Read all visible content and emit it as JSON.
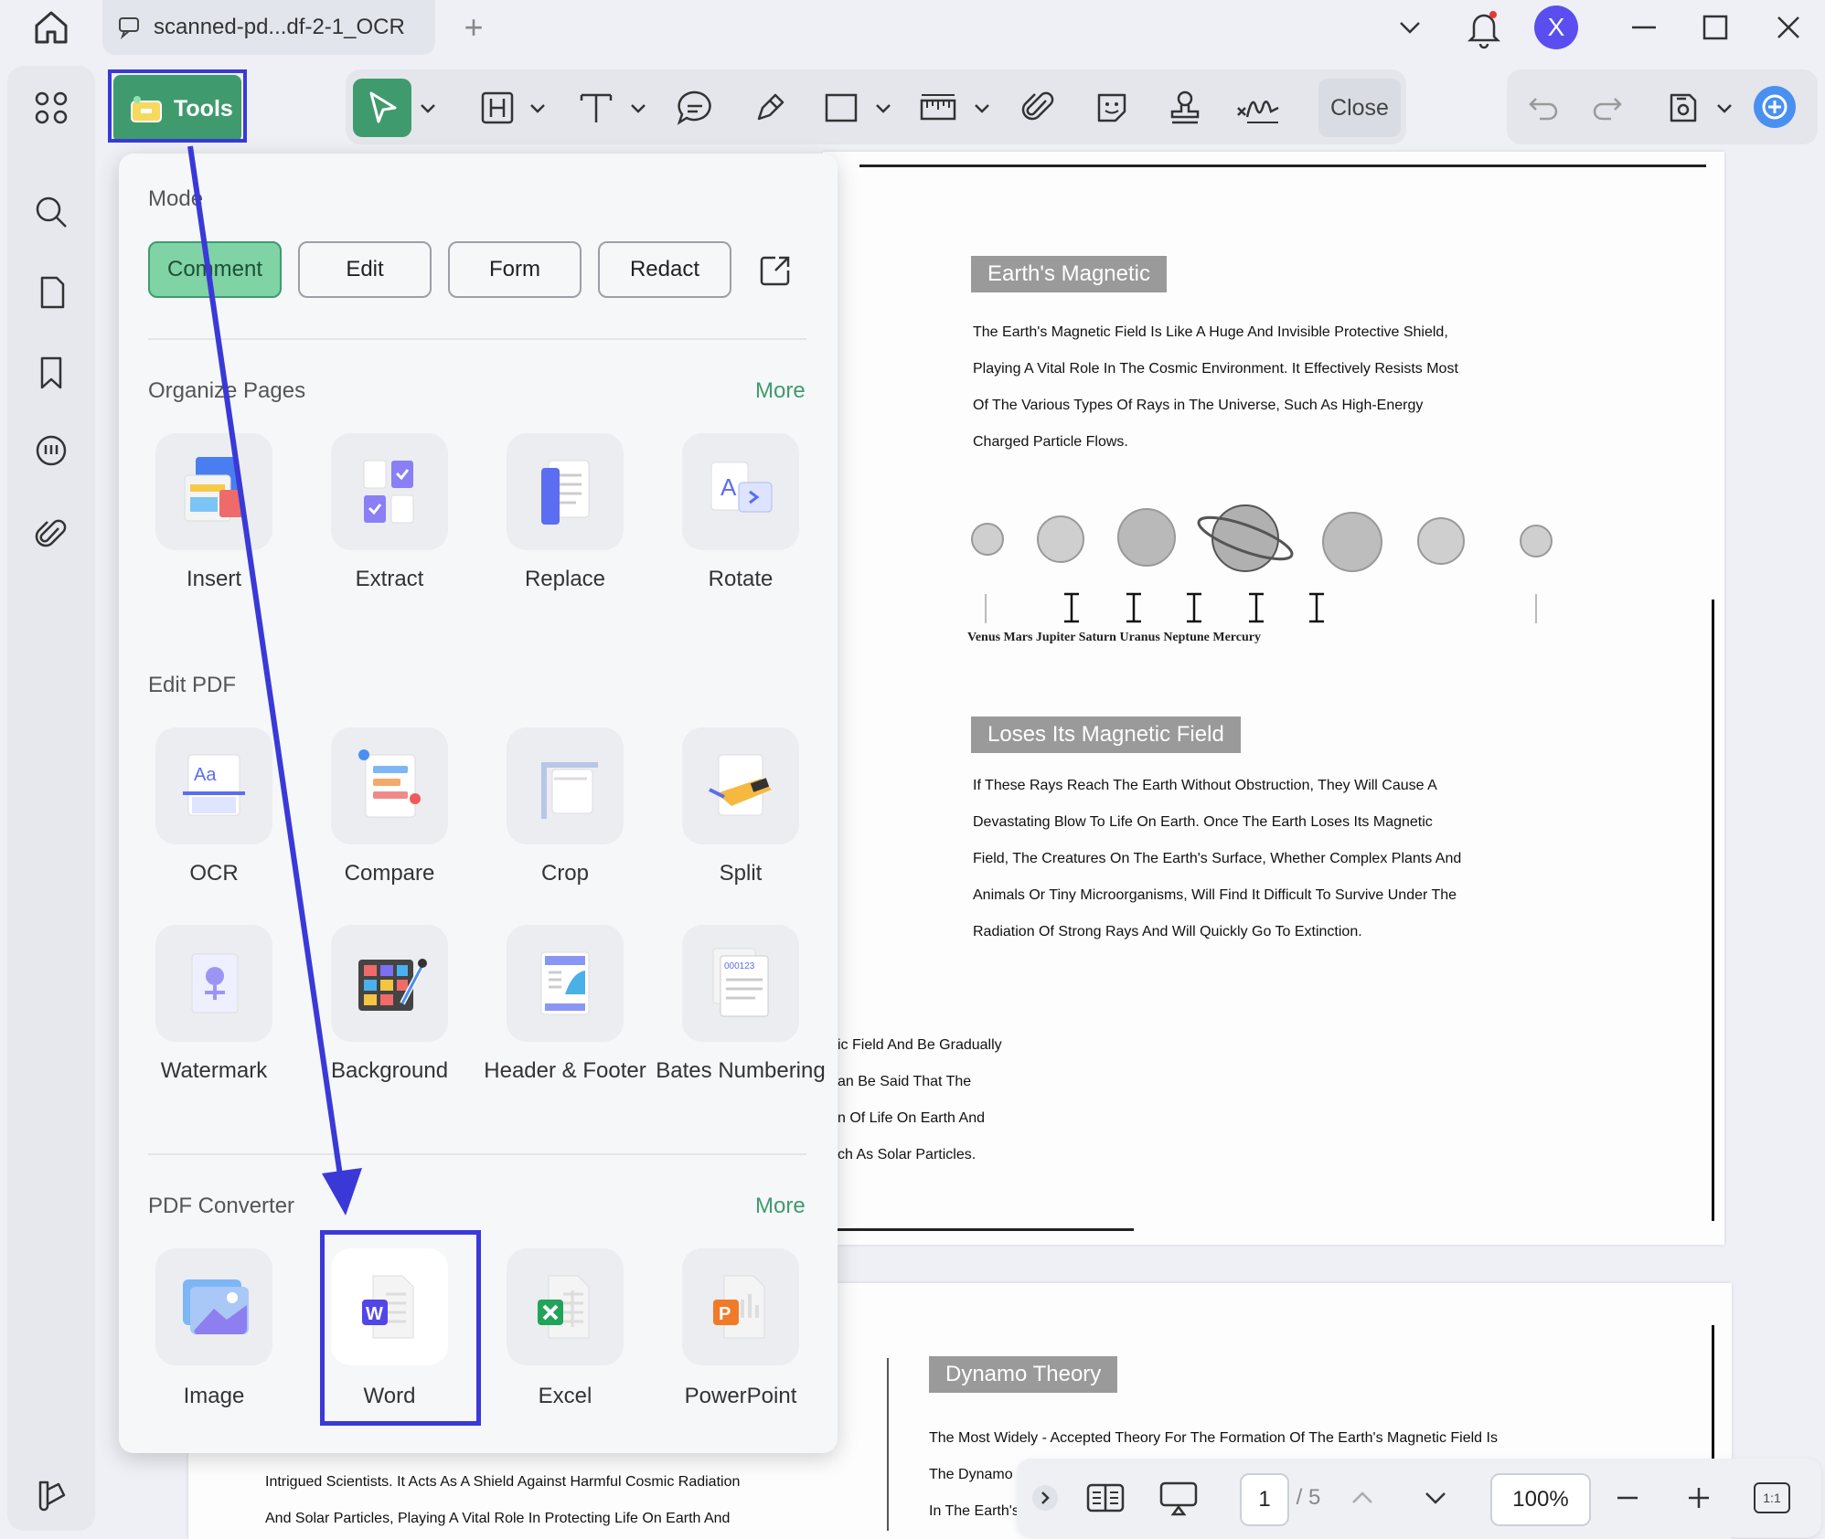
{
  "window": {
    "tab_title": "scanned-pd...df-2-1_OCR",
    "new_tab": "+",
    "avatar_letter": "X"
  },
  "toolbar": {
    "tools_label": "Tools",
    "close_label": "Close"
  },
  "panel": {
    "mode_title": "Mode",
    "modes": [
      "Comment",
      "Edit",
      "Form",
      "Redact"
    ],
    "active_mode": "Comment",
    "organize_title": "Organize Pages",
    "organize_more": "More",
    "organize_items": [
      "Insert",
      "Extract",
      "Replace",
      "Rotate"
    ],
    "edit_title": "Edit PDF",
    "edit_items": [
      "OCR",
      "Compare",
      "Crop",
      "Split",
      "Watermark",
      "Background",
      "Header & Footer",
      "Bates Numbering"
    ],
    "converter_title": "PDF Converter",
    "converter_more": "More",
    "converter_items": [
      "Image",
      "Word",
      "Excel",
      "PowerPoint"
    ]
  },
  "document": {
    "heading1": "Earth's Magnetic",
    "para1": [
      "The Earth's Magnetic Field Is Like A Huge And Invisible Protective Shield,",
      "Playing A Vital Role In The Cosmic Environment. It Effectively Resists Most",
      "Of The Various Types Of Rays in The Universe, Such As High-Energy",
      "Charged Particle Flows."
    ],
    "planet_labels": "Venus Mars Jupiter Saturn Uranus Neptune Mercury",
    "heading2": "Loses Its Magnetic Field",
    "para2": [
      "If These Rays Reach The Earth Without Obstruction, They Will Cause A",
      "Devastating Blow To Life On Earth. Once The Earth Loses Its Magnetic",
      "Field, The Creatures On The Earth's Surface, Whether Complex Plants And",
      "Animals Or Tiny Microorganisms, Will Find It Difficult To Survive Under The",
      "Radiation Of Strong Rays And Will Quickly Go To Extinction."
    ],
    "para3": [
      "ic Field And Be Gradually",
      "an Be Said That The",
      "n Of Life On Earth And",
      "ch As Solar Particles."
    ],
    "heading3": "Dynamo Theory",
    "para4": [
      "The Most Widely - Accepted Theory For The Formation Of The Earth's Magnetic Field Is",
      "The Dynamo",
      "In The Earth's"
    ],
    "para5": [
      "Intrigued Scientists. It Acts As A Shield Against Harmful Cosmic Radiation",
      "And Solar Particles, Playing A Vital Role In Protecting Life On Earth And"
    ]
  },
  "statusbar": {
    "current_page": "1",
    "total_pages": "/ 5",
    "zoom": "100%",
    "fit_label": "1:1"
  },
  "colors": {
    "accent_green": "#3f9b6e",
    "annotation_blue": "#3a39d8",
    "avatar_purple": "#5b4ef0"
  }
}
